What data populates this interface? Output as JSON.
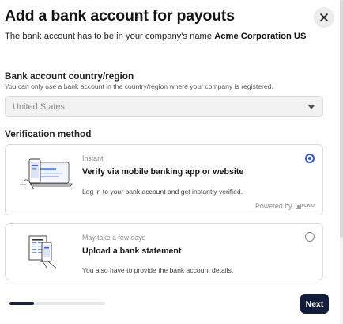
{
  "modal": {
    "title": "Add a bank account for payouts",
    "subtitle_prefix": "The bank account has to be in your company's name",
    "company_name": "Acme Corporation US"
  },
  "country": {
    "label": "Bank account country/region",
    "helper": "You can only use a bank account in the country/region where your company is registered.",
    "selected": "United States"
  },
  "verification": {
    "label": "Verification method",
    "options": [
      {
        "tag": "Instant",
        "title": "Verify via mobile banking app or website",
        "description": "Log in to your bank account and get instantly verified.",
        "powered_by": "Powered by",
        "provider": "PLAID",
        "selected": true,
        "illustration": "phone-laptop-icon"
      },
      {
        "tag": "May take a few days",
        "title": "Upload a bank statement",
        "description": "You also have to provide the bank account details.",
        "selected": false,
        "illustration": "document-phone-icon"
      }
    ]
  },
  "footer": {
    "progress": 0.26,
    "next_label": "Next"
  },
  "colors": {
    "primary": "#101d3b",
    "radio_selected": "#2e53d4",
    "border": "#dcdcdc"
  }
}
